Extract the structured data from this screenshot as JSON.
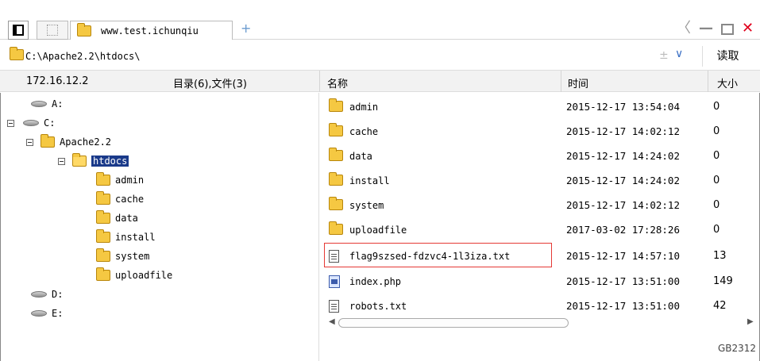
{
  "tab": {
    "label": "www.test.ichunqiu",
    "new_tab": "+"
  },
  "window_controls": {
    "back": "〈",
    "minimize": "—",
    "close": "✕"
  },
  "address": {
    "path": "C:\\Apache2.2\\htdocs\\",
    "plus": "±",
    "dropdown": "∨",
    "read_button": "读取"
  },
  "header": {
    "host_ip": "172.16.12.2",
    "summary": "目录(6),文件(3)",
    "name": "名称",
    "time": "时间",
    "size": "大小"
  },
  "tree": {
    "drive_a": "A:",
    "drive_c": "C:",
    "apache": "Apache2.2",
    "htdocs": "htdocs",
    "children": [
      "admin",
      "cache",
      "data",
      "install",
      "system",
      "uploadfile"
    ],
    "drive_d": "D:",
    "drive_e": "E:"
  },
  "files": [
    {
      "name": "admin",
      "time": "2015-12-17 13:54:04",
      "size": "0",
      "icon": "folder-icon"
    },
    {
      "name": "cache",
      "time": "2015-12-17 14:02:12",
      "size": "0",
      "icon": "folder-icon"
    },
    {
      "name": "data",
      "time": "2015-12-17 14:24:02",
      "size": "0",
      "icon": "folder-icon"
    },
    {
      "name": "install",
      "time": "2015-12-17 14:24:02",
      "size": "0",
      "icon": "folder-icon"
    },
    {
      "name": "system",
      "time": "2015-12-17 14:02:12",
      "size": "0",
      "icon": "folder-icon"
    },
    {
      "name": "uploadfile",
      "time": "2017-03-02 17:28:26",
      "size": "0",
      "icon": "folder-icon"
    },
    {
      "name": "flag9szsed-fdzvc4-1l3iza.txt",
      "time": "2015-12-17 14:57:10",
      "size": "13",
      "icon": "text-file-icon"
    },
    {
      "name": "index.php",
      "time": "2015-12-17 13:51:00",
      "size": "149",
      "icon": "php-file-icon"
    },
    {
      "name": "robots.txt",
      "time": "2015-12-17 13:51:00",
      "size": "42",
      "icon": "text-file-icon"
    }
  ],
  "status": {
    "encoding": "GB2312"
  },
  "colors": {
    "selection": "#1a3a8a",
    "highlight_box": "#e53935",
    "folder": "#f5c842",
    "close": "#e0001b"
  }
}
